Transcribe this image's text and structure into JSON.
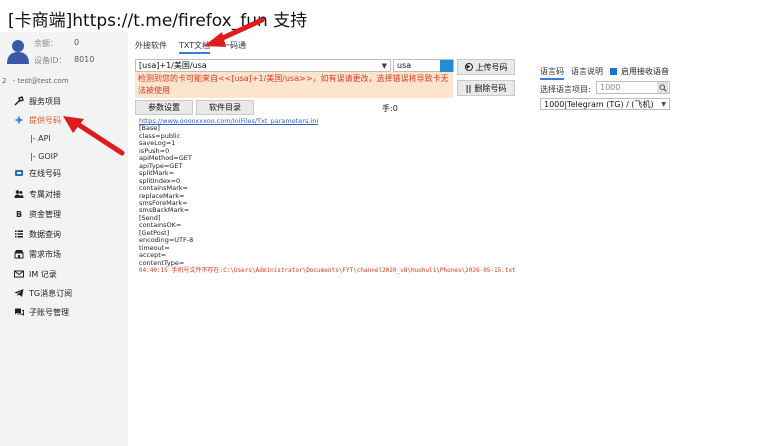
{
  "window": {
    "title": "[卡商端]https://t.me/firefox_fun 支持"
  },
  "account": {
    "balance_label": "余额：",
    "balance_value": "0",
    "device_label": "设备ID：",
    "device_value": "8010",
    "user_index": "2",
    "user_email": "test@test.com"
  },
  "sidebar": {
    "items": [
      {
        "label": "服务项目",
        "icon": "wrench-icon"
      },
      {
        "label": "提供号码",
        "icon": "star-icon"
      },
      {
        "label": "在线号码",
        "icon": "sim-icon"
      },
      {
        "label": "专属对接",
        "icon": "people-icon"
      },
      {
        "label": "资金管理",
        "icon": "bitcoin-icon"
      },
      {
        "label": "数据查询",
        "icon": "list-icon"
      },
      {
        "label": "需求市场",
        "icon": "store-icon"
      },
      {
        "label": "IM 记录",
        "icon": "mail-icon"
      },
      {
        "label": "TG消息订阅",
        "icon": "telegram-icon"
      },
      {
        "label": "子账号管理",
        "icon": "chat-icon"
      }
    ],
    "subitems": [
      {
        "label": "|-  API"
      },
      {
        "label": "|-  GOIP"
      }
    ]
  },
  "tabs": [
    {
      "label": "外接软件"
    },
    {
      "label": "TXT文档"
    },
    {
      "label": "一码通"
    }
  ],
  "form": {
    "project_select": "[usa]+1/美国/usa",
    "search_value": "usa",
    "warning": "检测到您的卡可能来自<<[usa]+1/美国/usa>>，如有误请更改，选择错误将导致卡无法被使用",
    "params_button": "参数设置",
    "dir_button": "软件目录",
    "count_label": "手:0",
    "upload_button": "上传号码",
    "delete_button": "删除号码"
  },
  "right_panel": {
    "tabs": [
      {
        "label": "语言码"
      },
      {
        "label": "语言说明"
      }
    ],
    "voice_checkbox_label": "启用接收语音",
    "select_label": "选择语言项目:",
    "select_input": "1000",
    "project_dropdown": "1000|Telegram (TG) / (飞机)"
  },
  "content": {
    "link": "https://www.ooooxxxoo.com/IniFiles/Txt_parameters.ini",
    "lines": [
      "[Base]",
      "class=public",
      "saveLog=1",
      "isPush=0",
      "apiMethod=GET",
      "apiType=GET",
      "splitMark=",
      "splitIndex=0",
      "containsMark=",
      "replaceMark=",
      "smsForeMark=",
      "smsBackMark=",
      "[Send]",
      "containsOK=",
      "[GetPost]",
      "encoding=UTF-8",
      "timeout=",
      "accept=",
      "contentType="
    ],
    "error_line": "04:40:15 手机号文件不存在:C:\\Users\\Administrator\\Documents\\FYT\\channel2020_v8\\Huohuli\\Phones\\2026-05-15.txt"
  },
  "colors": {
    "accent": "#3a7bd5",
    "warning": "#e03a1a",
    "arrow": "#e01b1b"
  }
}
